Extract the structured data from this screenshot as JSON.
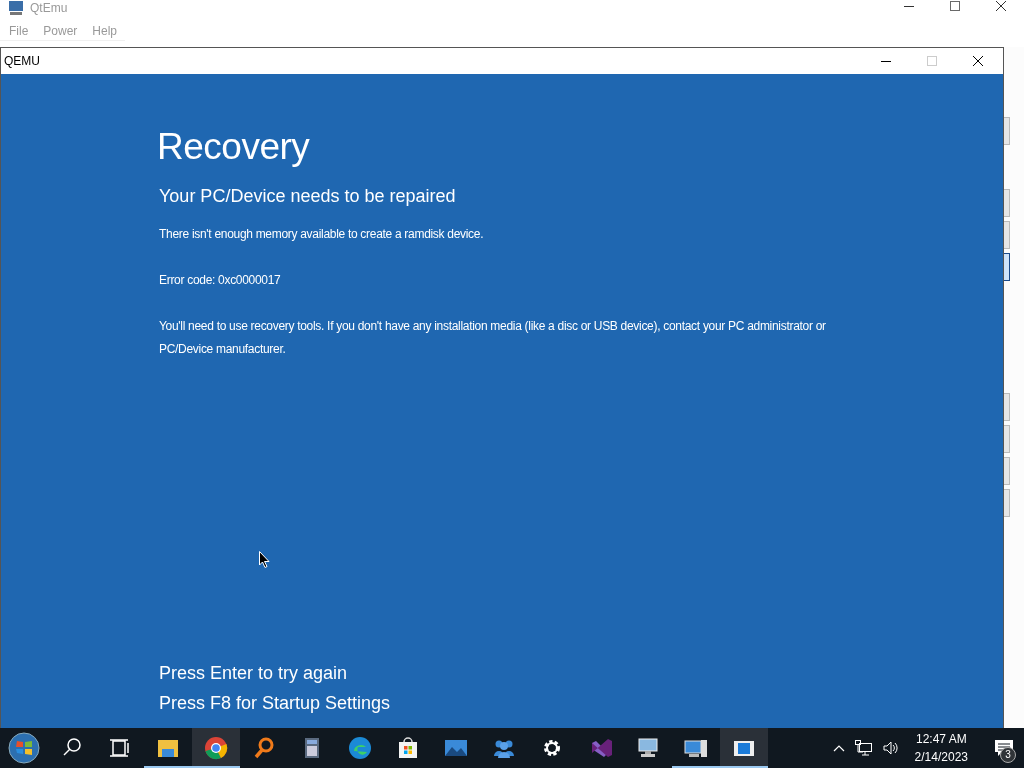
{
  "app": {
    "title": "QtEmu",
    "menu": [
      "File",
      "Power",
      "Help"
    ]
  },
  "vm_window": {
    "title": "QEMU",
    "screen": {
      "heading": "Recovery",
      "subheading": "Your PC/Device needs to be repaired",
      "messages": [
        "There isn't enough memory available to create a ramdisk device.",
        "Error code: 0xc0000017",
        "You'll need to use recovery tools. If you don't have any installation media (like a disc or USB device), contact your PC administrator or PC/Device manufacturer."
      ],
      "prompts": [
        "Press Enter to try again",
        "Press F8 for Startup Settings"
      ]
    }
  },
  "taskbar": {
    "items": [
      {
        "kind": "start",
        "running": false,
        "selected": false
      },
      {
        "kind": "search",
        "running": false,
        "selected": false
      },
      {
        "kind": "taskview",
        "running": false,
        "selected": false
      },
      {
        "kind": "folder",
        "running": true,
        "selected": false
      },
      {
        "kind": "chrome",
        "running": true,
        "selected": true
      },
      {
        "kind": "magnifier",
        "running": false,
        "selected": false
      },
      {
        "kind": "calculator",
        "running": false,
        "selected": false
      },
      {
        "kind": "edge",
        "running": false,
        "selected": false
      },
      {
        "kind": "store",
        "running": false,
        "selected": false
      },
      {
        "kind": "photo",
        "running": false,
        "selected": false
      },
      {
        "kind": "people",
        "running": false,
        "selected": false
      },
      {
        "kind": "settings",
        "running": false,
        "selected": false
      },
      {
        "kind": "vs",
        "running": false,
        "selected": false
      },
      {
        "kind": "remote",
        "running": false,
        "selected": false
      },
      {
        "kind": "computer",
        "running": true,
        "selected": false
      },
      {
        "kind": "window",
        "running": true,
        "selected": true
      }
    ],
    "time": "12:47 AM",
    "date": "2/14/2023",
    "notification_count": "3"
  }
}
